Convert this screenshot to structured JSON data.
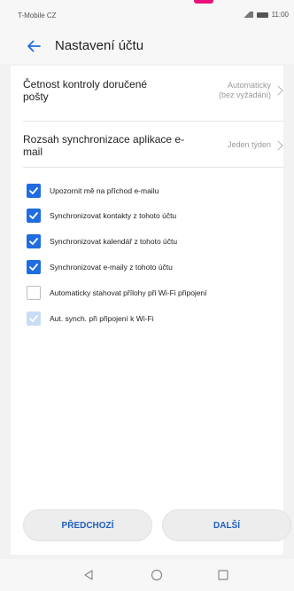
{
  "status_bar": {
    "carrier": "T-Mobile CZ",
    "time": "11:00"
  },
  "app_bar": {
    "title": "Nastavení účtu"
  },
  "preferences": [
    {
      "title_line1": "Četnost kontroly doručené",
      "title_line2": "pošty",
      "value_line1": "Automaticky",
      "value_line2": "(bez vyžádání)"
    },
    {
      "title_line1": "Rozsah synchronizace aplikace e-",
      "title_line2": "mail",
      "value_line1": "Jeden týden"
    }
  ],
  "checkboxes": [
    {
      "label": "Upozornit mě na příchod e-mailu",
      "checked": true,
      "enabled": true
    },
    {
      "label": "Synchronizovat kontakty z tohoto účtu",
      "checked": true,
      "enabled": true
    },
    {
      "label": "Synchronizovat kalendář z tohoto účtu",
      "checked": true,
      "enabled": true
    },
    {
      "label": "Synchronizovat e-maily z tohoto účtu",
      "checked": true,
      "enabled": true
    },
    {
      "label": "Automaticky stahovat přílohy při Wi-Fi připojení",
      "checked": false,
      "enabled": true
    },
    {
      "label": "Aut. synch. při připojení k Wi-Fi",
      "checked": true,
      "enabled": false
    }
  ],
  "buttons": {
    "previous": "PŘEDCHOZÍ",
    "next": "DALŠÍ"
  },
  "colors": {
    "accent": "#1f6de0",
    "button_text": "#1f5fbf",
    "brand_mark": "#e8137a"
  },
  "icons": {
    "back": "arrow-left-icon",
    "nav_back": "triangle-back-icon",
    "nav_home": "circle-home-icon",
    "nav_recents": "square-recents-icon"
  }
}
